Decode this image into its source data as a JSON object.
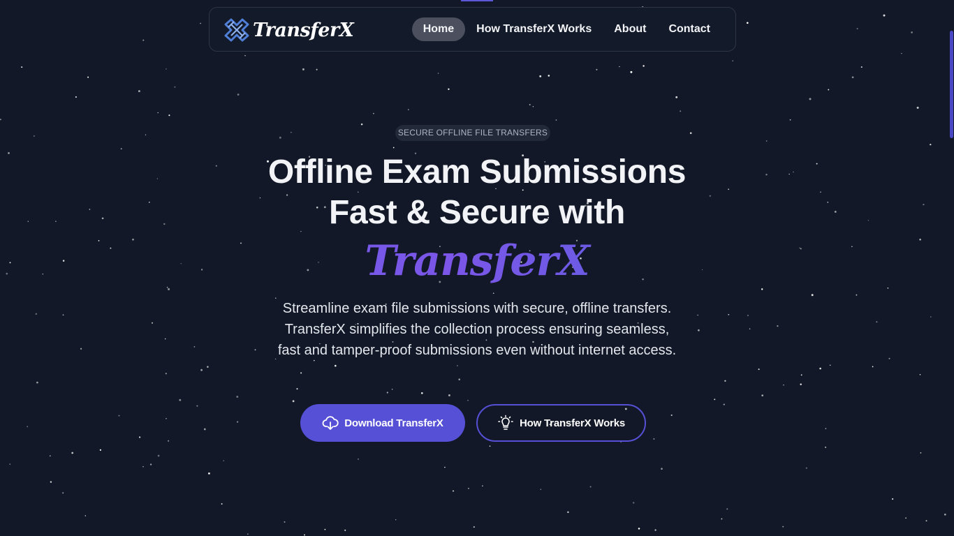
{
  "brand": {
    "name": "TransferX",
    "logo_icon": "transferx-logo-icon",
    "accent_color": "#5550d6"
  },
  "nav": {
    "items": [
      {
        "label": "Home",
        "active": true
      },
      {
        "label": "How TransferX Works",
        "active": false
      },
      {
        "label": "About",
        "active": false
      },
      {
        "label": "Contact",
        "active": false
      }
    ]
  },
  "hero": {
    "badge": "SECURE OFFLINE FILE TRANSFERS",
    "title_line1": "Offline Exam Submissions",
    "title_line2": "Fast & Secure with",
    "title_brand": "TransferX",
    "description": "Streamline exam file submissions with secure, offline transfers. TransferX simplifies the collection process ensuring seamless, fast and tamper-proof submissions even without internet access."
  },
  "buttons": {
    "download": {
      "label": "Download TransferX",
      "icon": "cloud-download-icon"
    },
    "how_it_works": {
      "label": "How TransferX Works",
      "icon": "lightbulb-icon"
    }
  }
}
